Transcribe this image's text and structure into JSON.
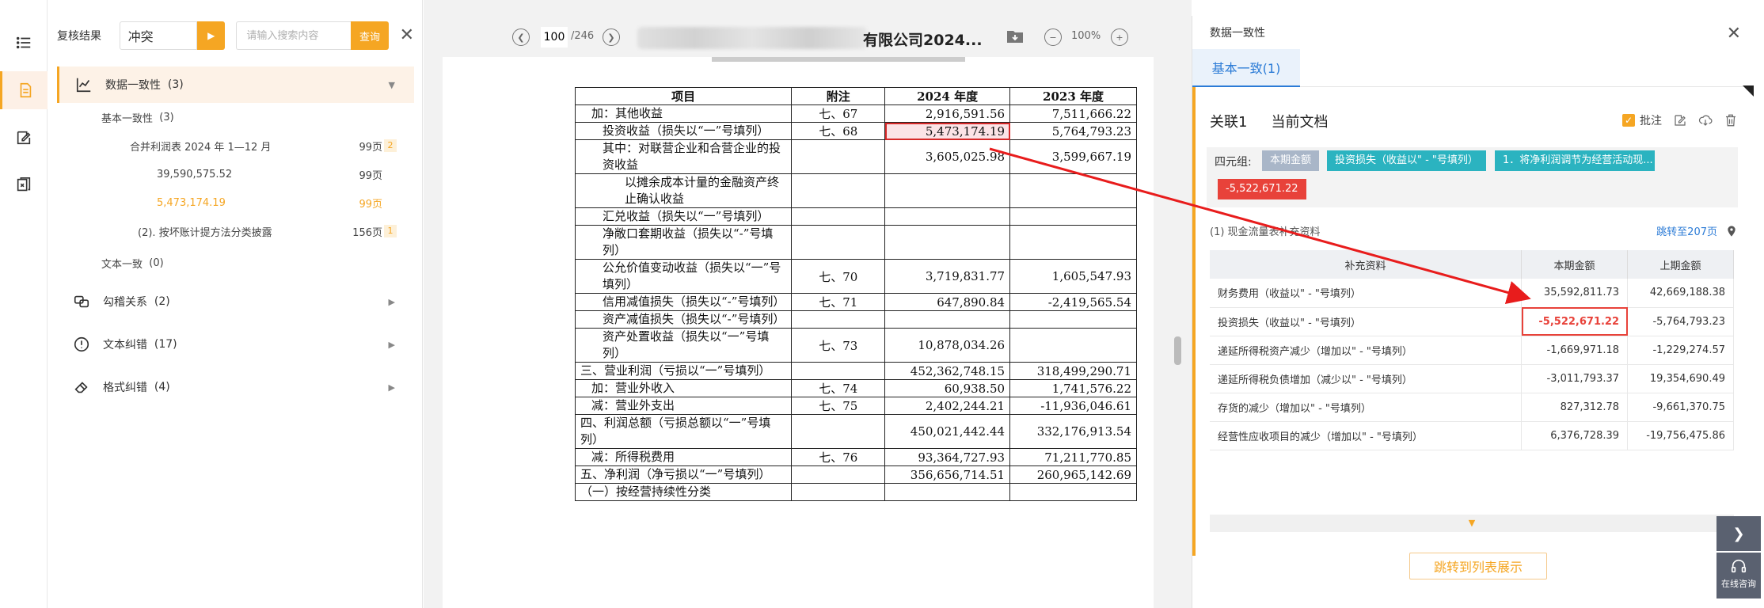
{
  "review": {
    "title": "复核结果",
    "select_value": "冲突",
    "search_placeholder": "请输入搜索内容",
    "search_button": "查询",
    "tree": {
      "data_consistency": "数据一致性",
      "data_consistency_count": "(3)",
      "basic": "基本一致性",
      "basic_count": "(3)",
      "leaf1": "合并利润表 2024 年 1—12 月",
      "leaf1_page": "99页",
      "leaf1_count": "2",
      "leaf1_v1": "39,590,575.52",
      "leaf1_v1_page": "99页",
      "leaf1_v2": "5,473,174.19",
      "leaf1_v2_page": "99页",
      "leaf2": "(2). 按坏账计提方法分类披露",
      "leaf2_page": "156页",
      "leaf2_count": "1",
      "text_consistency": "文本一致",
      "text_consistency_count": "(0)",
      "tick": "勾稽关系",
      "tick_count": "(2)",
      "text_error": "文本纠错",
      "text_error_count": "(17)",
      "format_error": "格式纠错",
      "format_error_count": "(4)"
    }
  },
  "viewer": {
    "page_current": "100",
    "page_total": "/246",
    "doc_title": "有限公司2024...",
    "zoom": "100%",
    "table": {
      "headers": [
        "项目",
        "附注",
        "2024 年度",
        "2023 年度"
      ],
      "rows": [
        {
          "item": "加：其他收益",
          "note": "七、67",
          "y2024": "2,916,591.56",
          "y2023": "7,511,666.22",
          "indent": 1
        },
        {
          "item": "投资收益（损失以“一”号填列）",
          "note": "七、68",
          "y2024": "5,473,174.19",
          "y2023": "5,764,793.23",
          "indent": 2,
          "hl": true
        },
        {
          "item": "其中：对联营企业和合营企业的投资收益",
          "note": "",
          "y2024": "3,605,025.98",
          "y2023": "3,599,667.19",
          "indent": 2
        },
        {
          "item": "以摊余成本计量的金融资产终止确认收益",
          "note": "",
          "y2024": "",
          "y2023": "",
          "indent": 4
        },
        {
          "item": "汇兑收益（损失以“一”号填列）",
          "note": "",
          "y2024": "",
          "y2023": "",
          "indent": 2
        },
        {
          "item": "净敞口套期收益（损失以“-”号填列）",
          "note": "",
          "y2024": "",
          "y2023": "",
          "indent": 2
        },
        {
          "item": "公允价值变动收益（损失以“一”号填列）",
          "note": "七、70",
          "y2024": "3,719,831.77",
          "y2023": "1,605,547.93",
          "indent": 2
        },
        {
          "item": "信用减值损失（损失以“-”号填列）",
          "note": "七、71",
          "y2024": "647,890.84",
          "y2023": "-2,419,565.54",
          "indent": 2
        },
        {
          "item": "资产减值损失（损失以“-”号填列）",
          "note": "",
          "y2024": "",
          "y2023": "",
          "indent": 2
        },
        {
          "item": "资产处置收益（损失以“一”号填列）",
          "note": "七、73",
          "y2024": "10,878,034.26",
          "y2023": "",
          "indent": 2
        },
        {
          "item": "三、营业利润（亏损以“一”号填列）",
          "note": "",
          "y2024": "452,362,748.15",
          "y2023": "318,499,290.71",
          "indent": 0
        },
        {
          "item": "加：营业外收入",
          "note": "七、74",
          "y2024": "60,938.50",
          "y2023": "1,741,576.22",
          "indent": 1
        },
        {
          "item": "减：营业外支出",
          "note": "七、75",
          "y2024": "2,402,244.21",
          "y2023": "-11,936,046.61",
          "indent": 1
        },
        {
          "item": "四、利润总额（亏损总额以“一”号填列）",
          "note": "",
          "y2024": "450,021,442.44",
          "y2023": "332,176,913.54",
          "indent": 0
        },
        {
          "item": "减：所得税费用",
          "note": "七、76",
          "y2024": "93,364,727.93",
          "y2023": "71,211,770.85",
          "indent": 1
        },
        {
          "item": "五、净利润（净亏损以“一”号填列）",
          "note": "",
          "y2024": "356,656,714.51",
          "y2023": "260,965,142.69",
          "indent": 0
        },
        {
          "item": "（一）按经营持续性分类",
          "note": "",
          "y2024": "",
          "y2023": "",
          "indent": 0
        }
      ]
    }
  },
  "consistency": {
    "title": "数据一致性",
    "tab": "基本一致(1)",
    "relation": "关联1",
    "current_doc": "当前文档",
    "annotate": "批注",
    "quad_label": "四元组:",
    "tag_period": "本期金额",
    "tag_item": "投资损失（收益以\" - \"号填列）",
    "tag_adjust": "1．将净利润调节为经营活动现...",
    "tag_value": "-5,522,671.22",
    "section": "(1) 现金流量表补充资料",
    "jump": "跳转至207页",
    "sup_headers": [
      "补充资料",
      "本期金额",
      "上期金额"
    ],
    "sup_rows": [
      {
        "name": "财务费用（收益以\" - \"号填列）",
        "cur": "35,592,811.73",
        "prev": "42,669,188.38"
      },
      {
        "name": "投资损失（收益以\" - \"号填列）",
        "cur": "-5,522,671.22",
        "prev": "-5,764,793.23",
        "hl": true
      },
      {
        "name": "递延所得税资产减少（增加以\" - \"号填列）",
        "cur": "-1,669,971.18",
        "prev": "-1,229,274.57"
      },
      {
        "name": "递延所得税负债增加（减少以\" - \"号填列）",
        "cur": "-3,011,793.37",
        "prev": "19,354,690.49"
      },
      {
        "name": "存货的减少（增加以\" - \"号填列）",
        "cur": "827,312.78",
        "prev": "-9,661,370.75"
      },
      {
        "name": "经营性应收项目的减少（增加以\" - \"号填列）",
        "cur": "6,376,728.39",
        "prev": "-19,756,475.86"
      }
    ],
    "list_button": "跳转到列表展示",
    "online": "在线咨询"
  },
  "colors": {
    "accent": "#f5a623",
    "link": "#2b7bd6",
    "alert": "#e8423a"
  }
}
